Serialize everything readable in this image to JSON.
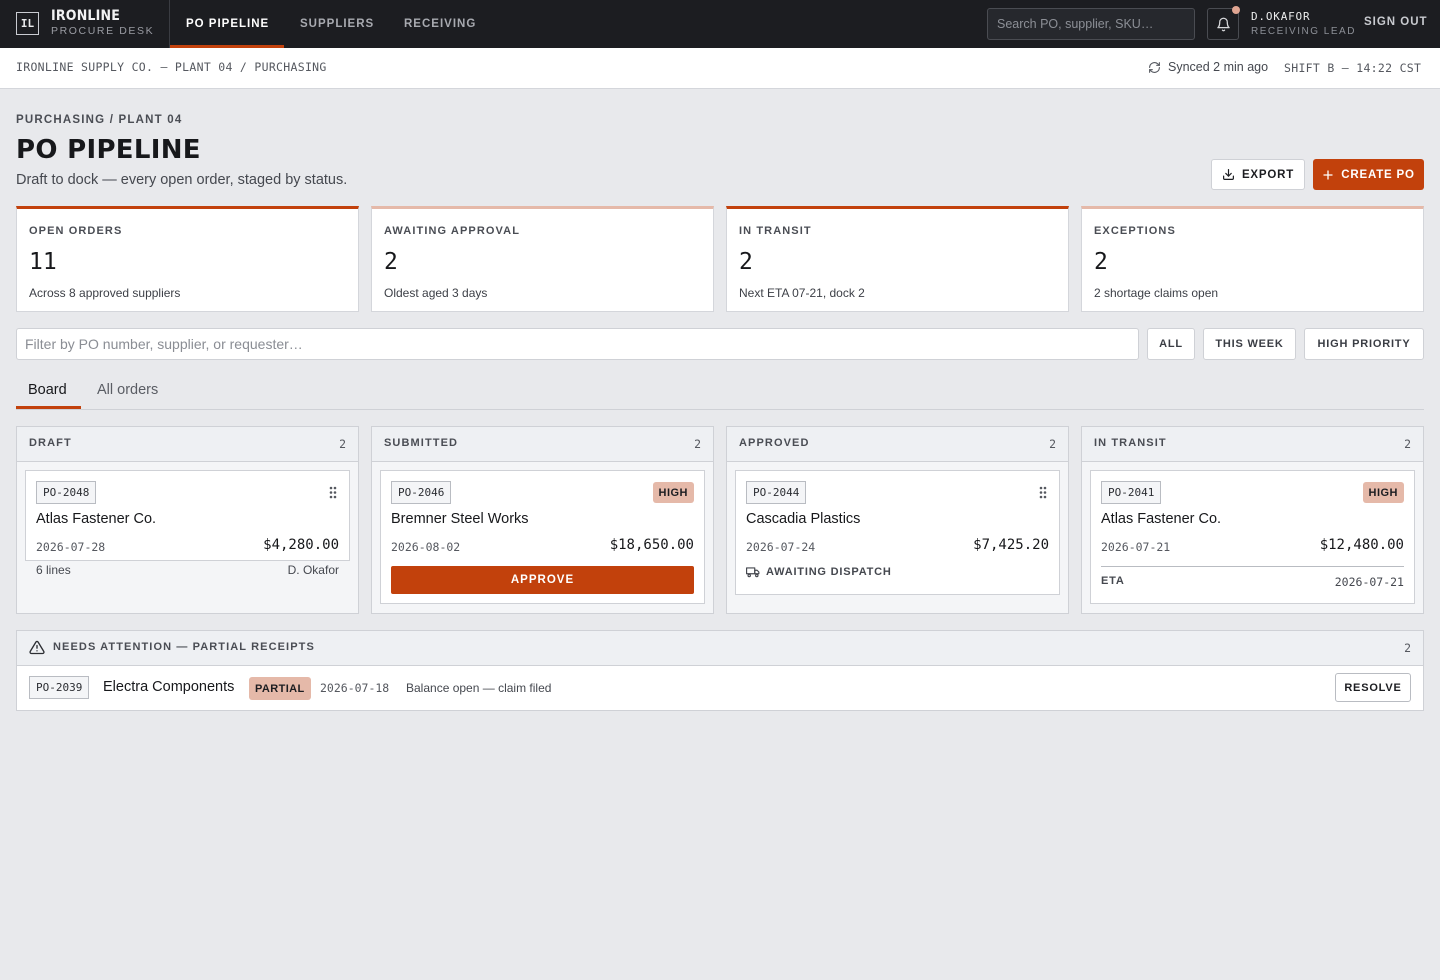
{
  "app": {
    "logo": "IL",
    "name": "IRONLINE",
    "subtitle": "PROCURE DESK"
  },
  "nav": {
    "tabs": [
      "PO PIPELINE",
      "SUPPLIERS",
      "RECEIVING"
    ],
    "active": "PO PIPELINE"
  },
  "search": {
    "placeholder": "Search PO, supplier, SKU…"
  },
  "user": {
    "name": "D.OKAFOR",
    "role": "RECEIVING LEAD",
    "signout": "SIGN OUT",
    "has_notification": true
  },
  "subbar": {
    "breadcrumb": "IRONLINE SUPPLY CO. — PLANT 04 / PURCHASING",
    "sync": "Synced 2 min ago",
    "shift": "SHIFT B — 14:22 CST"
  },
  "header": {
    "eyebrow": "PURCHASING / PLANT 04",
    "title": "PO PIPELINE",
    "subtitle": "Draft to dock — every open order, staged by status.",
    "export_label": "EXPORT",
    "create_label": "CREATE PO"
  },
  "stats": [
    {
      "label": "OPEN ORDERS",
      "value": "11",
      "note": "Across 8 approved suppliers"
    },
    {
      "label": "AWAITING APPROVAL",
      "value": "2",
      "note": "Oldest aged 3 days"
    },
    {
      "label": "IN TRANSIT",
      "value": "2",
      "note": "Next ETA 07-21, dock 2"
    },
    {
      "label": "EXCEPTIONS",
      "value": "2",
      "note": "2 shortage claims open"
    }
  ],
  "filter": {
    "placeholder": "Filter by PO number, supplier, or requester…",
    "chips": [
      "ALL",
      "THIS WEEK",
      "HIGH PRIORITY"
    ]
  },
  "views": {
    "tabs": [
      "Board",
      "All orders"
    ],
    "active": "Board"
  },
  "board": {
    "columns": [
      {
        "title": "DRAFT",
        "count": "2",
        "card": {
          "po": "PO-2048",
          "supplier": "Atlas Fastener Co.",
          "date": "2026-07-28",
          "amount": "$4,280.00",
          "lines": "6 lines",
          "requester": "D. Okafor"
        }
      },
      {
        "title": "SUBMITTED",
        "count": "2",
        "card": {
          "po": "PO-2046",
          "priority": "HIGH",
          "supplier": "Bremner Steel Works",
          "date": "2026-08-02",
          "amount": "$18,650.00",
          "action": "APPROVE"
        }
      },
      {
        "title": "APPROVED",
        "count": "2",
        "card": {
          "po": "PO-2044",
          "supplier": "Cascadia Plastics",
          "date": "2026-07-24",
          "amount": "$7,425.20",
          "status": "AWAITING DISPATCH"
        }
      },
      {
        "title": "IN TRANSIT",
        "count": "2",
        "card": {
          "po": "PO-2041",
          "priority": "HIGH",
          "supplier": "Atlas Fastener Co.",
          "date": "2026-07-21",
          "amount": "$12,480.00",
          "eta_label": "ETA",
          "eta": "2026-07-21"
        }
      }
    ]
  },
  "attention": {
    "title": "NEEDS ATTENTION — PARTIAL RECEIPTS",
    "count": "2",
    "row": {
      "po": "PO-2039",
      "supplier": "Electra Components",
      "badge": "PARTIAL",
      "date": "2026-07-18",
      "note": "Balance open — claim filed",
      "action": "RESOLVE"
    }
  },
  "colors": {
    "accent": "#c2410c",
    "accent_soft": "#e5b9a9",
    "nav_bg": "#1c1d21",
    "page_bg": "#e8e9ec"
  }
}
